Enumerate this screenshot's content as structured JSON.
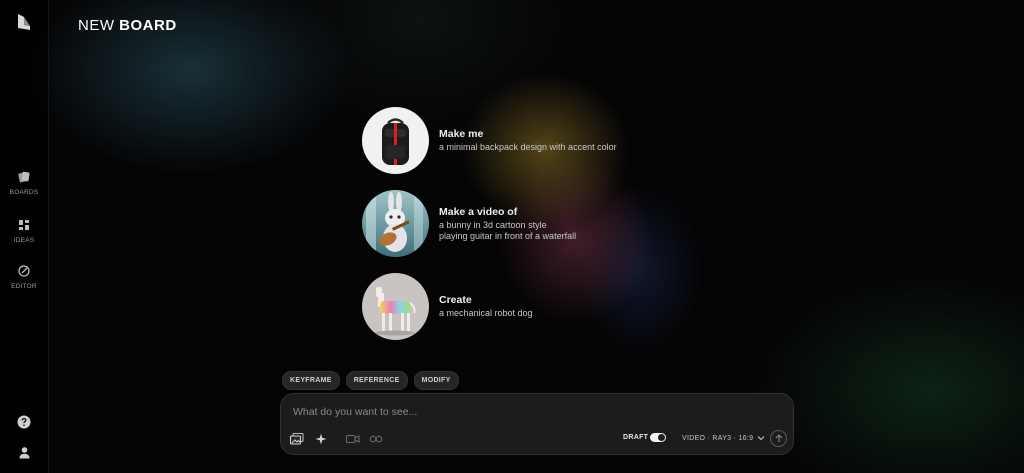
{
  "header": {
    "title_prefix": "NEW",
    "title_bold": "BOARD"
  },
  "sidebar": {
    "items": [
      {
        "label": "BOARDS",
        "icon": "boards-icon"
      },
      {
        "label": "IDEAS",
        "icon": "ideas-icon"
      },
      {
        "label": "EDITOR",
        "icon": "editor-icon"
      }
    ],
    "bottom": [
      "help-icon",
      "user-icon"
    ]
  },
  "suggestions": [
    {
      "title": "Make me",
      "description": "a minimal backpack design with accent color",
      "image": "backpack"
    },
    {
      "title": "Make a video of",
      "description": "a bunny in 3d cartoon style\nplaying guitar in front of a waterfall",
      "image": "bunny-guitar"
    },
    {
      "title": "Create",
      "description": "a mechanical robot dog",
      "image": "robot-dog"
    }
  ],
  "chips": [
    "KEYFRAME",
    "REFERENCE",
    "MODIFY"
  ],
  "prompt": {
    "placeholder": "What do you want to see...",
    "value": "",
    "tools": [
      "image-icon",
      "sparkle-icon",
      "video-icon",
      "loop-icon"
    ],
    "draft_label": "DRAFT",
    "draft_on": true,
    "model_label": "VIDEO · RAY3 · 16:9"
  }
}
